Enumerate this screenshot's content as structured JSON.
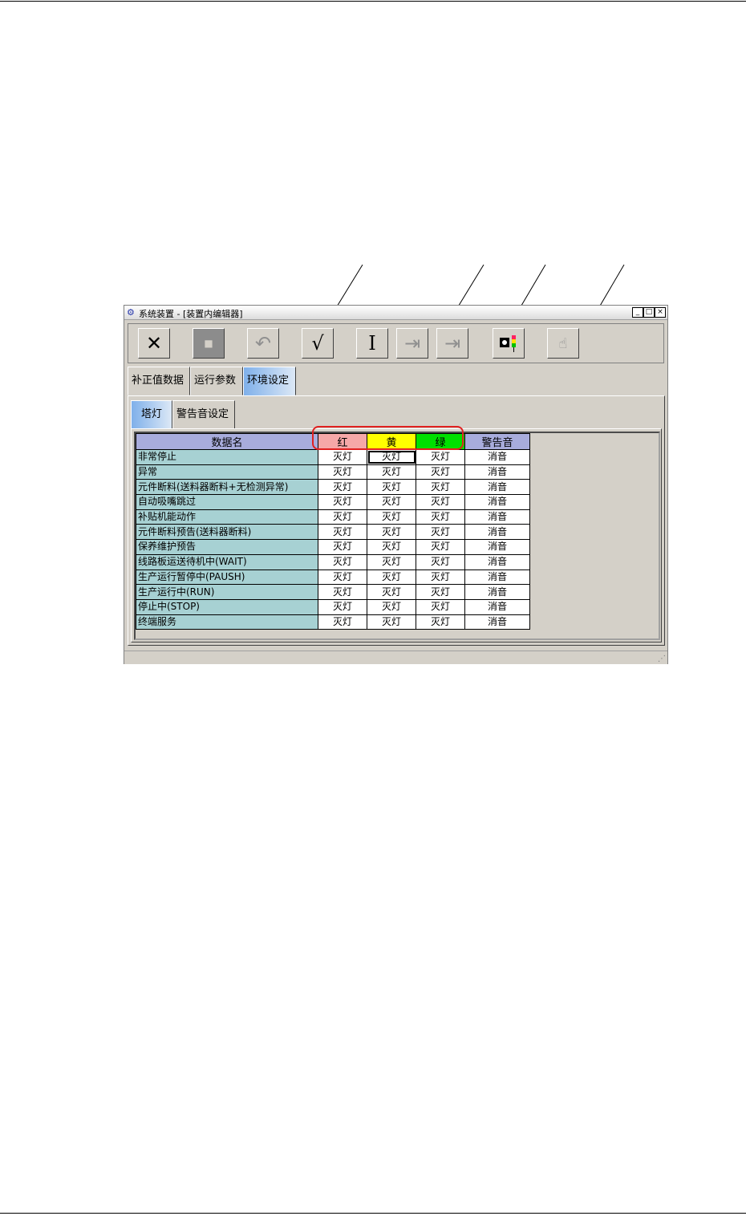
{
  "window": {
    "title": "系统装置 - [装置内编辑器]",
    "buttons": [
      "_",
      "□",
      "×"
    ]
  },
  "toolbar": {
    "close_glyph": "✕",
    "stop_glyph": "■",
    "undo_glyph": "↶",
    "check_glyph": "√",
    "cursor_glyph": "I",
    "jump1_glyph": "⇥",
    "jump2_glyph": "⇥",
    "tower_glyph": "◍",
    "hand_glyph": "☝"
  },
  "tabs": [
    "补正值数据",
    "运行参数",
    "环境设定"
  ],
  "subtabs": [
    "塔灯",
    "警告音设定"
  ],
  "table": {
    "headers": {
      "name": "数据名",
      "red": "红",
      "yellow": "黄",
      "green": "绿",
      "sound": "警告音"
    },
    "header_colors": {
      "name": "#a8acdc",
      "red": "#f6a8a8",
      "yellow": "#ffff00",
      "green": "#00e000",
      "sound": "#a8acdc"
    },
    "rows": [
      {
        "name": "非常停止",
        "red": "灭灯",
        "yellow": "灭灯",
        "green": "灭灯",
        "sound": "消音"
      },
      {
        "name": "异常",
        "red": "灭灯",
        "yellow": "灭灯",
        "green": "灭灯",
        "sound": "消音"
      },
      {
        "name": "元件断料(送料器断料+无检测异常)",
        "red": "灭灯",
        "yellow": "灭灯",
        "green": "灭灯",
        "sound": "消音"
      },
      {
        "name": "自动吸嘴跳过",
        "red": "灭灯",
        "yellow": "灭灯",
        "green": "灭灯",
        "sound": "消音"
      },
      {
        "name": "补贴机能动作",
        "red": "灭灯",
        "yellow": "灭灯",
        "green": "灭灯",
        "sound": "消音"
      },
      {
        "name": "元件断料预告(送料器断料)",
        "red": "灭灯",
        "yellow": "灭灯",
        "green": "灭灯",
        "sound": "消音"
      },
      {
        "name": "保养维护预告",
        "red": "灭灯",
        "yellow": "灭灯",
        "green": "灭灯",
        "sound": "消音"
      },
      {
        "name": "线路板运送待机中(WAIT)",
        "red": "灭灯",
        "yellow": "灭灯",
        "green": "灭灯",
        "sound": "消音"
      },
      {
        "name": "生产运行暂停中(PAUSH)",
        "red": "灭灯",
        "yellow": "灭灯",
        "green": "灭灯",
        "sound": "消音"
      },
      {
        "name": "生产运行中(RUN)",
        "red": "灭灯",
        "yellow": "灭灯",
        "green": "灭灯",
        "sound": "消音"
      },
      {
        "name": "停止中(STOP)",
        "red": "灭灯",
        "yellow": "灭灯",
        "green": "灭灯",
        "sound": "消音"
      },
      {
        "name": "终端服务",
        "red": "灭灯",
        "yellow": "灭灯",
        "green": "灭灯",
        "sound": "消音"
      }
    ]
  },
  "status": {
    "grip_glyph": "⋰"
  }
}
